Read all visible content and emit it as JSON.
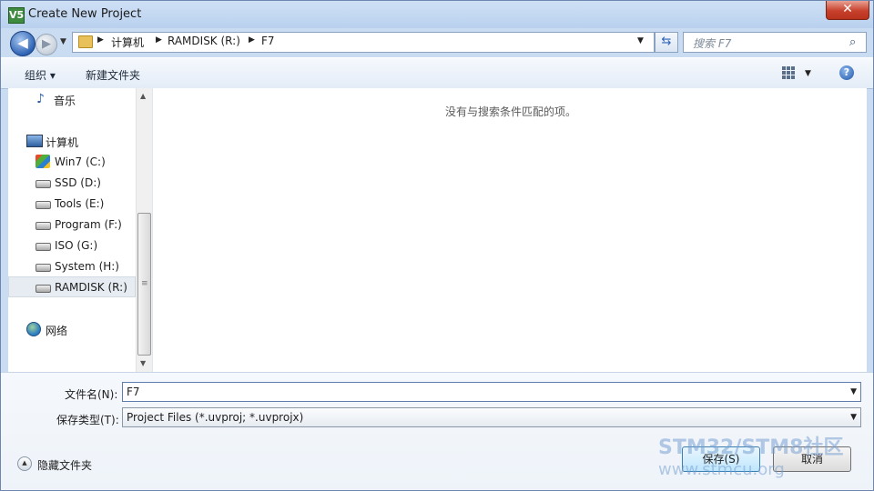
{
  "window": {
    "title": "Create New Project",
    "app_icon": "V5",
    "close_label": "✕"
  },
  "nav": {
    "breadcrumbs": [
      "计算机",
      "RAMDISK (R:)",
      "F7"
    ],
    "search_placeholder": "搜索 F7"
  },
  "toolbar": {
    "organize_label": "组织 ▾",
    "new_folder_label": "新建文件夹",
    "help_label": "?"
  },
  "sidebar": {
    "items": [
      {
        "label": "音乐",
        "icon": "music-icon"
      },
      {
        "label": "计算机",
        "icon": "computer-icon"
      },
      {
        "label": "Win7 (C:)",
        "icon": "windows-drive-icon"
      },
      {
        "label": "SSD (D:)",
        "icon": "drive-icon"
      },
      {
        "label": "Tools (E:)",
        "icon": "drive-icon"
      },
      {
        "label": "Program (F:)",
        "icon": "drive-icon"
      },
      {
        "label": "ISO (G:)",
        "icon": "drive-icon"
      },
      {
        "label": "System (H:)",
        "icon": "drive-icon"
      },
      {
        "label": "RAMDISK (R:)",
        "icon": "drive-icon",
        "selected": true
      },
      {
        "label": "网络",
        "icon": "network-icon"
      }
    ]
  },
  "content": {
    "empty_message": "没有与搜索条件匹配的项。"
  },
  "form": {
    "filename_label": "文件名(N):",
    "filename_value": "F7",
    "filetype_label": "保存类型(T):",
    "filetype_value": "Project Files (*.uvproj; *.uvprojx)"
  },
  "footer": {
    "hide_folders_label": "隐藏文件夹",
    "save_label": "保存(S)",
    "cancel_label": "取消"
  },
  "watermark": {
    "line1": "STM32/STM8社区",
    "line2": "www.stmcu.org"
  },
  "colors": {
    "title_bar": "#c9dcf2",
    "close_button": "#c7402c",
    "accent": "#2e63b5"
  }
}
